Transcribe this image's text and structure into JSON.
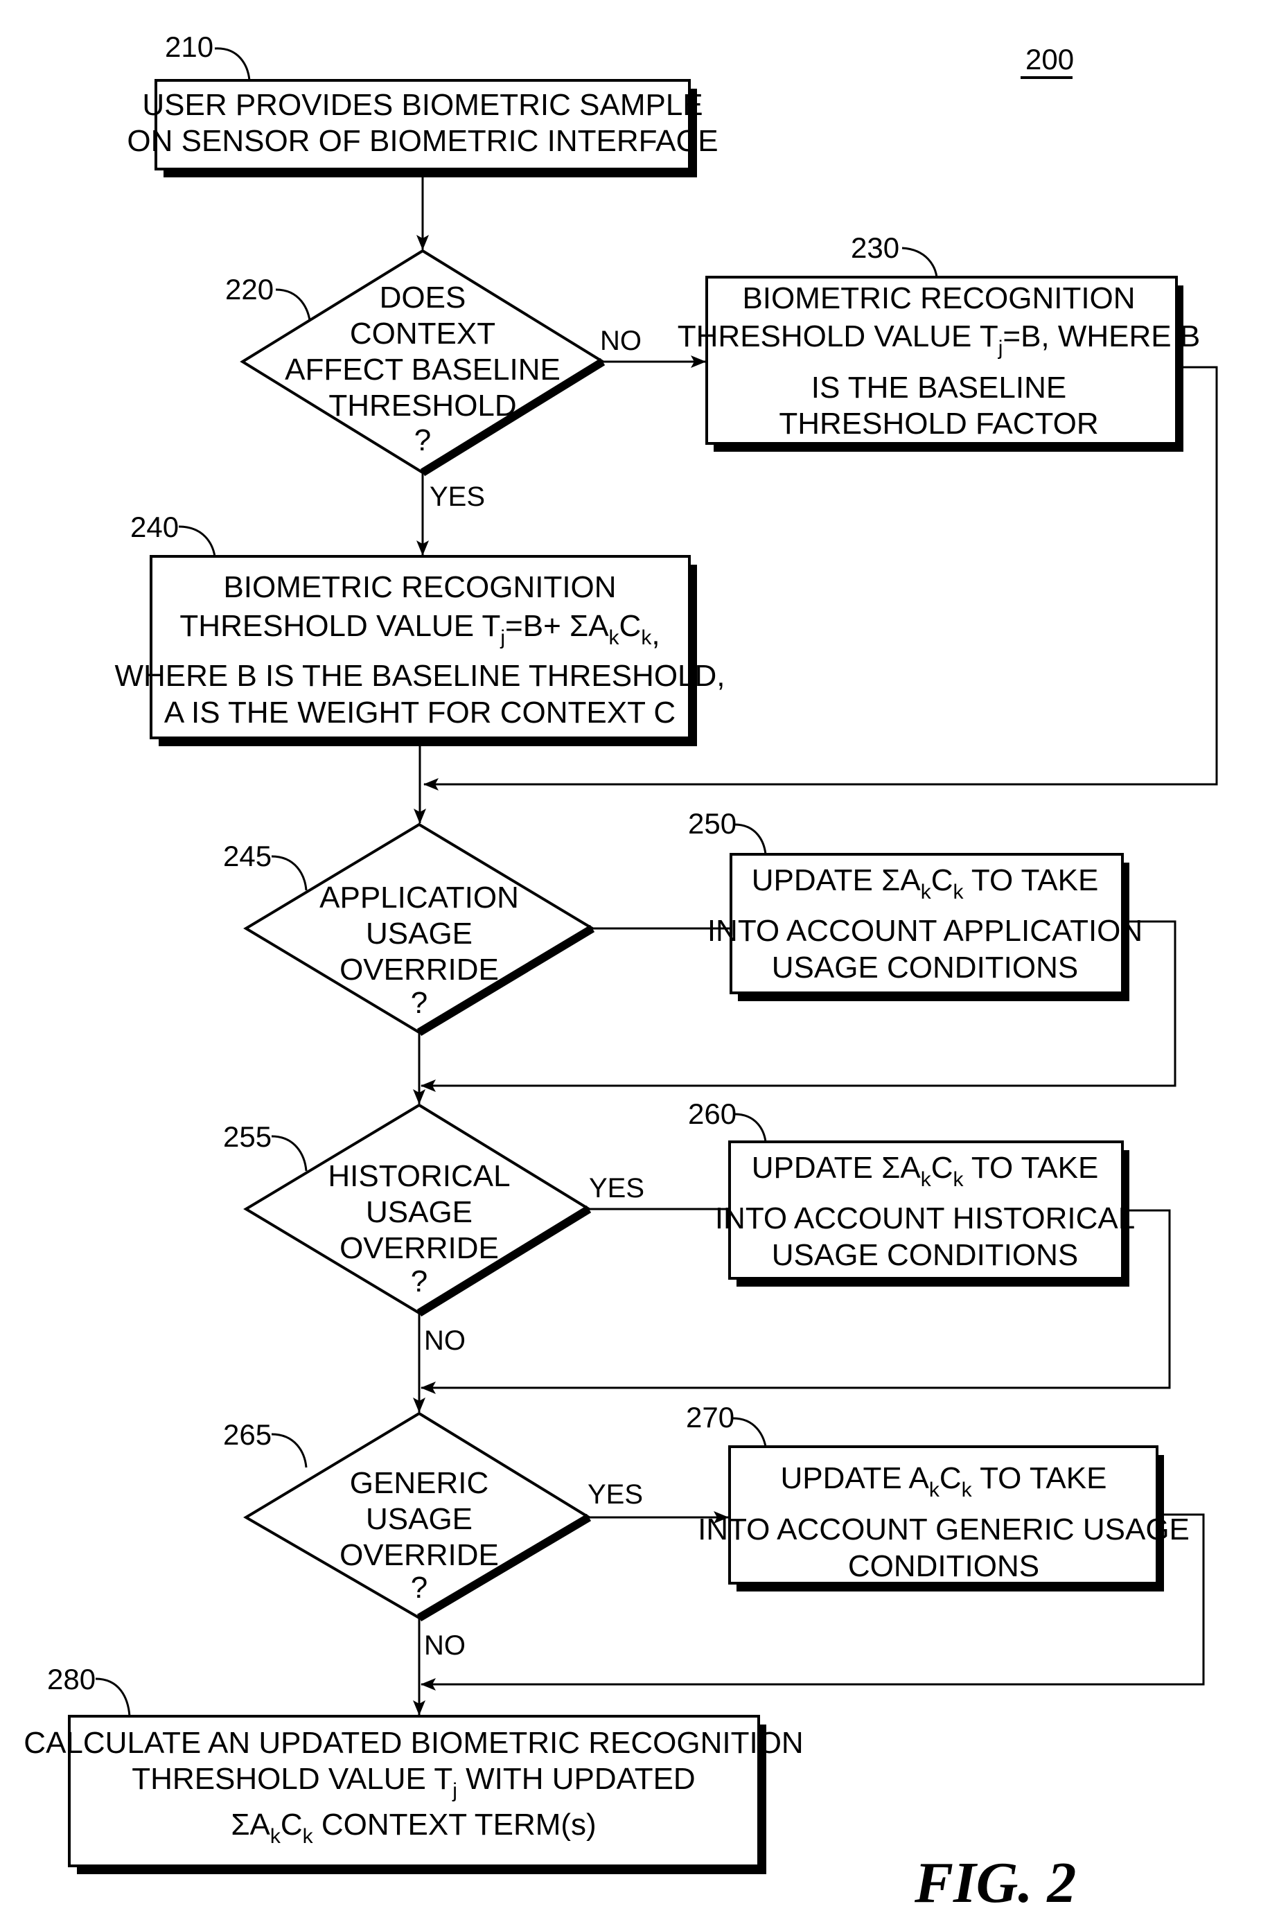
{
  "figure": {
    "number_label": "200",
    "caption": "FIG. 2"
  },
  "steps": {
    "s210": {
      "ref": "210",
      "type": "process",
      "lines": [
        "USER PROVIDES BIOMETRIC SAMPLE",
        "ON SENSOR OF BIOMETRIC INTERFACE"
      ]
    },
    "s220": {
      "ref": "220",
      "type": "decision",
      "lines": [
        "DOES",
        "CONTEXT",
        "AFFECT BASELINE",
        "THRESHOLD",
        "?"
      ],
      "yes_label": "YES",
      "no_label": "NO"
    },
    "s230": {
      "ref": "230",
      "type": "process",
      "lines": [
        "BIOMETRIC RECOGNITION",
        "THRESHOLD VALUE T",
        "j",
        "=B, WHERE B",
        "IS THE BASELINE",
        "THRESHOLD FACTOR"
      ]
    },
    "s240": {
      "ref": "240",
      "type": "process",
      "line1": "BIOMETRIC RECOGNITION",
      "line2_pre": "THRESHOLD VALUE T",
      "line2_sub_j": "j",
      "line2_mid": "=B+ ΣA",
      "line2_sub_k1": "k",
      "line2_c": "C",
      "line2_sub_k2": "k",
      "line2_post": ",",
      "line3": "WHERE B IS THE BASELINE THRESHOLD,",
      "line4": "A IS THE WEIGHT FOR CONTEXT C"
    },
    "s245": {
      "ref": "245",
      "type": "decision",
      "lines": [
        "APPLICATION",
        "USAGE",
        "OVERRIDE",
        "?"
      ]
    },
    "s250": {
      "ref": "250",
      "type": "process",
      "l1_pre": "UPDATE ΣA",
      "l1_k1": "k",
      "l1_c": "C",
      "l1_k2": "k",
      "l1_post": " TO TAKE",
      "line2": "INTO ACCOUNT APPLICATION",
      "line3": "USAGE CONDITIONS"
    },
    "s255": {
      "ref": "255",
      "type": "decision",
      "lines": [
        "HISTORICAL",
        "USAGE",
        "OVERRIDE",
        "?"
      ],
      "yes_label": "YES",
      "no_label": "NO"
    },
    "s260": {
      "ref": "260",
      "type": "process",
      "l1_pre": "UPDATE ΣA",
      "l1_k1": "k",
      "l1_c": "C",
      "l1_k2": "k",
      "l1_post": " TO TAKE",
      "line2": "INTO ACCOUNT HISTORICAL",
      "line3": "USAGE CONDITIONS"
    },
    "s265": {
      "ref": "265",
      "type": "decision",
      "lines": [
        "GENERIC",
        "USAGE",
        "OVERRIDE",
        "?"
      ],
      "yes_label": "YES",
      "no_label": "NO"
    },
    "s270": {
      "ref": "270",
      "type": "process",
      "l1_pre": "UPDATE  A",
      "l1_k1": "k",
      "l1_c": "C",
      "l1_k2": "k",
      "l1_post": " TO TAKE",
      "line2": "INTO ACCOUNT GENERIC USAGE",
      "line3": "CONDITIONS"
    },
    "s280": {
      "ref": "280",
      "type": "process",
      "line1": "CALCULATE AN UPDATED BIOMETRIC RECOGNITION",
      "l2_pre": "THRESHOLD VALUE T",
      "l2_j": "j",
      "l2_post": " WITH UPDATED",
      "l3_pre": "ΣA",
      "l3_k1": "k",
      "l3_c": "C",
      "l3_k2": "k",
      "l3_post": " CONTEXT TERM(s)"
    }
  }
}
